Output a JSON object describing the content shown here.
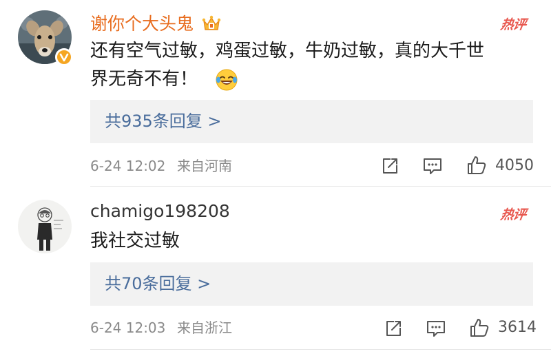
{
  "comments": [
    {
      "username": "谢你个大头鬼",
      "username_color": "#e86c1e",
      "avatar_icon": "deer-photo-avatar",
      "badge_icon": "verified-v-badge-icon",
      "user_badge_icon": "crown-vip-icon",
      "hot_label": "热评",
      "text_line1": "还有空气过敏，鸡蛋过敏，牛奶过敏，真的大千世",
      "text_line2": "界无奇不有！",
      "emoji_icon": "laughing-tears-emoji-icon",
      "reply_label": "共935条回复 >",
      "time": "6-24 12:02",
      "location": "来自河南",
      "likes": "4050"
    },
    {
      "username": "chamigo198208",
      "username_color": "#333333",
      "avatar_icon": "sketch-figure-avatar",
      "hot_label": "热评",
      "text_line1": "我社交过敏",
      "reply_label": "共70条回复 >",
      "time": "6-24 12:03",
      "location": "来自浙江",
      "likes": "3614"
    }
  ],
  "colors": {
    "hot_label": "#e8584f",
    "reply_link": "#4a6d9c",
    "meta_text": "#8a8a8a",
    "reply_bg": "#f2f2f2",
    "verified_badge": "#f5a623"
  }
}
